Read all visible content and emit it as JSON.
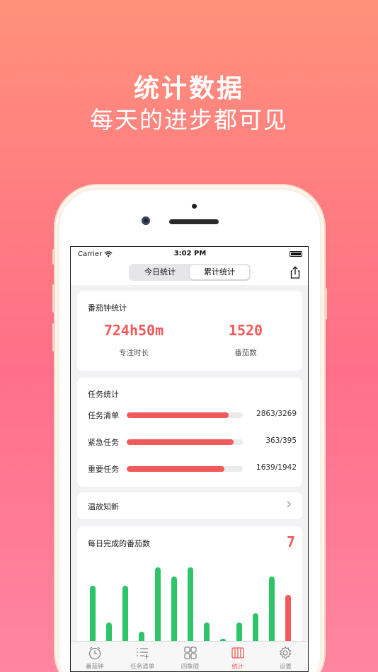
{
  "hero": {
    "title": "统计数据",
    "subtitle": "每天的进步都可见"
  },
  "status": {
    "carrier": "Carrier",
    "time": "3:02 PM"
  },
  "segment": {
    "options": [
      "今日统计",
      "累计统计"
    ],
    "selected": "累计统计"
  },
  "pomodoro_card": {
    "title": "番茄钟统计",
    "focus_value": "724h50m",
    "focus_label": "专注时长",
    "count_value": "1520",
    "count_label": "番茄数"
  },
  "task_card": {
    "title": "任务统计",
    "rows": [
      {
        "label": "任务清单",
        "value": "2863/3269",
        "progress": 0.876
      },
      {
        "label": "紧急任务",
        "value": "363/395",
        "progress": 0.919
      },
      {
        "label": "重要任务",
        "value": "1639/1942",
        "progress": 0.844
      }
    ]
  },
  "review": {
    "label": "温故知新"
  },
  "chart_card": {
    "title": "每日完成的番茄数",
    "today_value": "7"
  },
  "chart_data": {
    "type": "bar",
    "values": [
      6,
      2,
      6,
      1,
      8,
      7,
      8,
      2,
      0,
      2,
      3,
      7,
      5
    ],
    "highlight_index": 12,
    "colors": {
      "normal": "#2ec56a",
      "highlight": "#f05a5a"
    }
  },
  "tabs": [
    {
      "label": "番茄钟",
      "icon": "clock-icon",
      "active": false
    },
    {
      "label": "任务清单",
      "icon": "list-icon",
      "active": false
    },
    {
      "label": "四象限",
      "icon": "grid-icon",
      "active": false
    },
    {
      "label": "统计",
      "icon": "stats-icon",
      "active": true
    },
    {
      "label": "设置",
      "icon": "gear-icon",
      "active": false
    }
  ],
  "colors": {
    "accent": "#f05a5a",
    "green": "#2ec56a"
  }
}
